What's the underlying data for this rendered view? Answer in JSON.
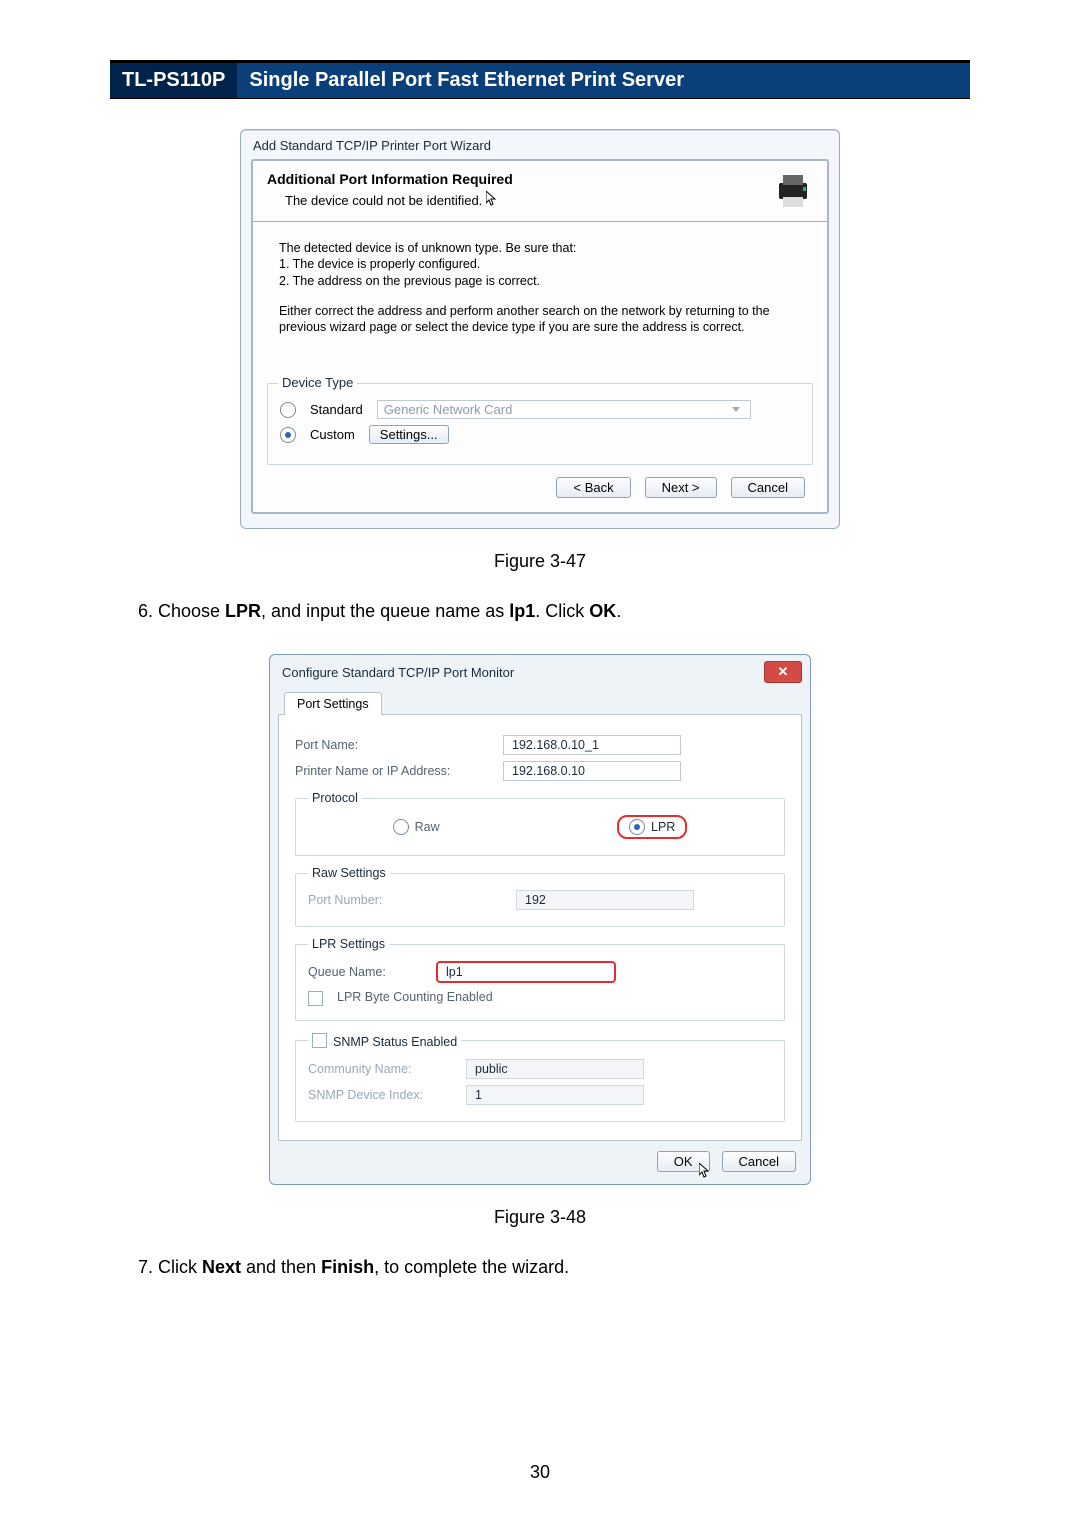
{
  "header": {
    "model": "TL-PS110P",
    "title": "Single Parallel Port Fast Ethernet Print Server"
  },
  "fig1": {
    "dlgTitle": "Add Standard TCP/IP Printer Port Wizard",
    "heading": "Additional Port Information Required",
    "subheading": "The device could not be identified.",
    "p1a": "The detected device is of unknown type.  Be sure that:",
    "p1b": "1. The device is properly configured.",
    "p1c": "2.  The address on the previous page is correct.",
    "p2": "Either correct the address and perform another search on the network by returning to the previous wizard page or select the device type if you are sure the address is correct.",
    "groupLabel": "Device Type",
    "standard": "Standard",
    "standardVal": "Generic Network Card",
    "custom": "Custom",
    "settingsBtn": "Settings...",
    "back": "< Back",
    "next": "Next >",
    "cancel": "Cancel",
    "caption": "Figure 3-47"
  },
  "step6": {
    "pre": "Choose ",
    "b1": "LPR",
    "mid": ", and input the queue name as ",
    "b2": "lp1",
    "mid2": ". Click ",
    "b3": "OK",
    "post": "."
  },
  "fig2": {
    "dlgTitle": "Configure Standard TCP/IP Port Monitor",
    "tabLabel": "Port Settings",
    "portNameL": "Port Name:",
    "portNameV": "192.168.0.10_1",
    "addrL": "Printer Name or IP Address:",
    "addrV": "192.168.0.10",
    "protoLegend": "Protocol",
    "raw": "Raw",
    "lpr": "LPR",
    "rawLegend": "Raw Settings",
    "rawPortL": "Port Number:",
    "rawPortV": "192",
    "lprLegend": "LPR Settings",
    "queueL": "Queue Name:",
    "queueV": "lp1",
    "lprByte": "LPR Byte Counting Enabled",
    "snmpLegend": "SNMP Status Enabled",
    "commL": "Community Name:",
    "commV": "public",
    "snmpIdxL": "SNMP Device Index:",
    "snmpIdxV": "1",
    "ok": "OK",
    "cancel": "Cancel",
    "caption": "Figure 3-48"
  },
  "step7": {
    "pre": "Click ",
    "b1": "Next",
    "mid": " and then ",
    "b2": "Finish",
    "post": ", to complete the wizard."
  },
  "pageNumber": "30"
}
